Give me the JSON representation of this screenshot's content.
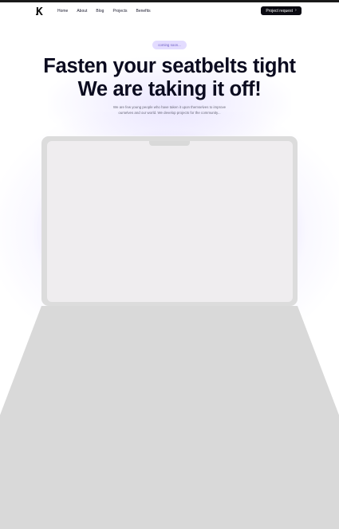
{
  "nav": {
    "logo_icon": "k-logo-icon",
    "links": [
      "Home",
      "About",
      "Blog",
      "Projects",
      "Benefits"
    ],
    "cta_label": "Project request",
    "cta_icon": "chevron-right-icon"
  },
  "hero": {
    "badge": "coming soon...",
    "headline_line1": "Fasten your seatbelts tight",
    "headline_line2": "We are taking it off!",
    "subtitle_line1": "We are few young people who have taken it upon themselves to improve",
    "subtitle_line2": "ourselves and our world. We develop projects for the community..."
  },
  "colors": {
    "accent_glow": "#7b5cff",
    "badge_bg": "#e3dcff",
    "cta_bg": "#0b0b12",
    "device_gray": "#dcdcdc"
  }
}
